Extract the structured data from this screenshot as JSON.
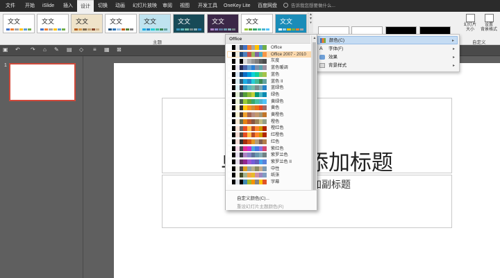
{
  "menu": {
    "tabs": [
      "文件",
      "开始",
      "iSlide",
      "插入",
      "设计",
      "切换",
      "动画",
      "幻灯片放映",
      "审阅",
      "视图",
      "开发工具",
      "OneKey Lite",
      "百度网盘"
    ],
    "active": "设计",
    "tell_me": "告诉我您想要做什么..."
  },
  "ribbon": {
    "theme_group_label": "主题",
    "thumb_text": "文文",
    "custom_group_label": "自定义",
    "slide_size_label": "幻灯片\n大小",
    "format_bg_label": "设置\n背景格式"
  },
  "slide_pane": {
    "slide_number": "1"
  },
  "slide": {
    "title": "单击此处添加标题",
    "subtitle": "单击此处添加副标题"
  },
  "submenu": {
    "items": [
      {
        "label": "颜色(C)",
        "highlighted": true
      },
      {
        "label": "字体(F)",
        "highlighted": false
      },
      {
        "label": "效果",
        "highlighted": false
      },
      {
        "label": "背景样式",
        "highlighted": false
      }
    ]
  },
  "dropdown": {
    "header": "Office",
    "selected": "Office 2007 - 2010",
    "items": [
      {
        "label": "Office",
        "colors": [
          "#ffffff",
          "#000000",
          "#e7e6e6",
          "#44546a",
          "#4472c4",
          "#ed7d31",
          "#a5a5a5",
          "#ffc000",
          "#5b9bd5",
          "#70ad47"
        ]
      },
      {
        "label": "Office 2007 - 2010",
        "colors": [
          "#ffffff",
          "#000000",
          "#eeece1",
          "#1f497d",
          "#4f81bd",
          "#c0504d",
          "#9bbb59",
          "#8064a2",
          "#4bacc6",
          "#f79646"
        ]
      },
      {
        "label": "灰度",
        "colors": [
          "#ffffff",
          "#000000",
          "#f8f8f8",
          "#000000",
          "#dddddd",
          "#b2b2b2",
          "#969696",
          "#808080",
          "#5f5f5f",
          "#4d4d4d"
        ]
      },
      {
        "label": "蓝色暖调",
        "colors": [
          "#ffffff",
          "#000000",
          "#e8e6f0",
          "#242852",
          "#4a66ac",
          "#629dd1",
          "#297fd5",
          "#7f8fa9",
          "#5aa2ae",
          "#9d90a0"
        ]
      },
      {
        "label": "蓝色",
        "colors": [
          "#ffffff",
          "#000000",
          "#dbe8f5",
          "#17406d",
          "#0f6fc6",
          "#009dd9",
          "#0bd0d9",
          "#10cf9b",
          "#7cca62",
          "#a5c249"
        ]
      },
      {
        "label": "蓝色 II",
        "colors": [
          "#ffffff",
          "#000000",
          "#dbeef3",
          "#335b74",
          "#1cade4",
          "#2683c6",
          "#27ced7",
          "#42ba97",
          "#3e8853",
          "#62a39f"
        ]
      },
      {
        "label": "蓝绿色",
        "colors": [
          "#ffffff",
          "#000000",
          "#d9f0f5",
          "#373545",
          "#3494ba",
          "#58b6c0",
          "#75bda7",
          "#7a8c8e",
          "#84acb6",
          "#2683c6"
        ]
      },
      {
        "label": "绿色",
        "colors": [
          "#ffffff",
          "#000000",
          "#e4efd5",
          "#455f51",
          "#549e39",
          "#8ab833",
          "#c0cf3a",
          "#029676",
          "#4ab5c4",
          "#0989b1"
        ]
      },
      {
        "label": "黄绿色",
        "colors": [
          "#ffffff",
          "#000000",
          "#eef5d8",
          "#455f51",
          "#99cb38",
          "#63a537",
          "#37a76f",
          "#44c1a3",
          "#4eb3cf",
          "#51c3f9"
        ]
      },
      {
        "label": "黄色",
        "colors": [
          "#ffffff",
          "#000000",
          "#fff8d6",
          "#39302a",
          "#ffca08",
          "#f8931d",
          "#ce8d3e",
          "#ec7016",
          "#e64823",
          "#9c6a6a"
        ]
      },
      {
        "label": "黄橙色",
        "colors": [
          "#ffffff",
          "#000000",
          "#fbf2d3",
          "#4e3b30",
          "#f0a22e",
          "#a5644e",
          "#b58b80",
          "#c3986d",
          "#a19574",
          "#c17529"
        ]
      },
      {
        "label": "橙色",
        "colors": [
          "#ffffff",
          "#000000",
          "#fde9d4",
          "#637052",
          "#e48312",
          "#bd582c",
          "#865640",
          "#9b8357",
          "#c2bc80",
          "#94a088"
        ]
      },
      {
        "label": "橙红色",
        "colors": [
          "#ffffff",
          "#000000",
          "#fbe2d5",
          "#696464",
          "#e84c22",
          "#ffbd47",
          "#b64926",
          "#ff8427",
          "#cc9900",
          "#b22600"
        ]
      },
      {
        "label": "红橙色",
        "colors": [
          "#ffffff",
          "#000000",
          "#f7dcd4",
          "#505046",
          "#e84c22",
          "#ffbd47",
          "#b64926",
          "#ff8427",
          "#cc9900",
          "#b22600"
        ]
      },
      {
        "label": "红色",
        "colors": [
          "#ffffff",
          "#000000",
          "#f6dcd8",
          "#323232",
          "#a5300f",
          "#d55816",
          "#e19825",
          "#b19c7d",
          "#7f5f52",
          "#b27d49"
        ]
      },
      {
        "label": "紫红色",
        "colors": [
          "#ffffff",
          "#000000",
          "#f5d8e8",
          "#454551",
          "#e32d91",
          "#c830cc",
          "#4ea6dc",
          "#4775e7",
          "#8971e1",
          "#d54773"
        ]
      },
      {
        "label": "紫罗兰色",
        "colors": [
          "#ffffff",
          "#000000",
          "#e9e0f0",
          "#373545",
          "#ad84c6",
          "#8784c7",
          "#5d739a",
          "#6997af",
          "#84acb6",
          "#6f8183"
        ]
      },
      {
        "label": "紫罗兰色 II",
        "colors": [
          "#ffffff",
          "#000000",
          "#e6dfec",
          "#632e62",
          "#92278f",
          "#9b57d3",
          "#755dd9",
          "#665eb8",
          "#45a5ed",
          "#5982db"
        ]
      },
      {
        "label": "中性",
        "colors": [
          "#ffffff",
          "#000000",
          "#eeece4",
          "#4e4a4a",
          "#dc9e1f",
          "#92a4a8",
          "#b9b08c",
          "#8b8c63",
          "#c9ac8c",
          "#7e9bb1"
        ]
      },
      {
        "label": "纸张",
        "colors": [
          "#ffffff",
          "#000000",
          "#f5f1e8",
          "#444d26",
          "#a5b592",
          "#f3a447",
          "#e7bc29",
          "#d092a7",
          "#9c85c0",
          "#809ec2"
        ]
      },
      {
        "label": "字幕",
        "colors": [
          "#ffffff",
          "#000000",
          "#dce0e6",
          "#000000",
          "#418ab3",
          "#a6b727",
          "#f69200",
          "#838383",
          "#fec306",
          "#df5327"
        ]
      }
    ],
    "custom_colors": "自定义颜色(C)...",
    "reset_colors": "重设幻灯片主题颜色(R)"
  }
}
